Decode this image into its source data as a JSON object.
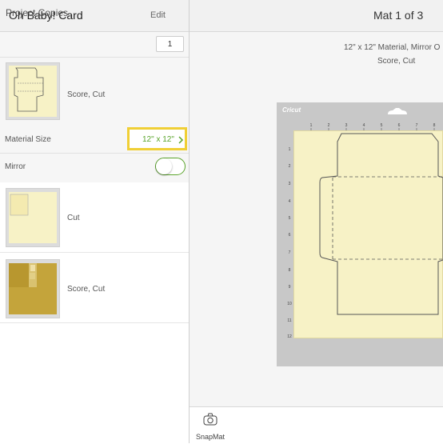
{
  "left_panel": {
    "project_title": "Oh Baby! Card",
    "edit_label": "Edit",
    "copies_label": "Project Copies",
    "copies_value": "1",
    "mats": [
      {
        "operations": "Score, Cut"
      },
      {
        "operations": "Cut"
      },
      {
        "operations": "Score, Cut"
      }
    ],
    "material_size_label": "Material Size",
    "material_size_value": "12\" x 12\"",
    "mirror_label": "Mirror",
    "mirror_on": false
  },
  "right_panel": {
    "mat_counter": "Mat 1 of 3",
    "material_line": "12\" x 12\" Material, Mirror O",
    "operation_line": "Score, Cut",
    "brand_logo": "Cricut",
    "ruler_top": [
      "1",
      "2",
      "3",
      "4",
      "5",
      "6",
      "7",
      "8"
    ],
    "ruler_left": [
      "1",
      "2",
      "3",
      "4",
      "5",
      "6",
      "7",
      "8",
      "9",
      "10",
      "11",
      "12"
    ]
  },
  "bottom_bar": {
    "snapmat_label": "SnapMat"
  },
  "colors": {
    "accent_green": "#5aa42a",
    "highlight_yellow": "#f0cf35",
    "material_cream": "#f7f2c6",
    "gold_material": "#c4a43b"
  },
  "icons": [
    "chevron-right-icon",
    "camera-icon",
    "mat-handle-icon"
  ]
}
